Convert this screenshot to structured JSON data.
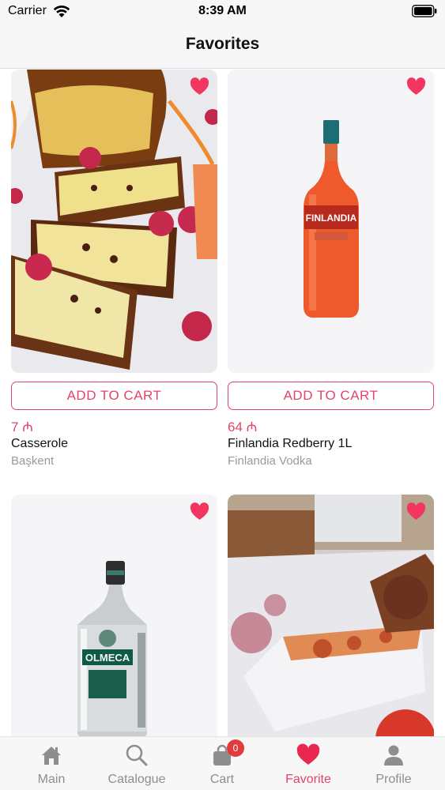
{
  "status_bar": {
    "carrier": "Carrier",
    "time": "8:39 AM"
  },
  "nav": {
    "title": "Favorites"
  },
  "products": [
    {
      "price": "7 ₼",
      "name": "Casserole",
      "brand": "Başkent",
      "add_label": "ADD TO CART",
      "image": "casserole-photo"
    },
    {
      "price": "64 ₼",
      "name": "Finlandia Redberry 1L",
      "brand": "Finlandia Vodka",
      "add_label": "ADD TO CART",
      "image": "finlandia-bottle",
      "bottle_label": "FINLANDIA"
    },
    {
      "image": "olmeca-bottle",
      "bottle_label": "OLMECA"
    },
    {
      "image": "dessert-roll-photo"
    }
  ],
  "tab_bar": {
    "tabs": [
      {
        "label": "Main",
        "icon": "home-icon"
      },
      {
        "label": "Catalogue",
        "icon": "search-icon"
      },
      {
        "label": "Cart",
        "icon": "bag-icon",
        "badge": "0"
      },
      {
        "label": "Favorite",
        "icon": "heart-icon",
        "active": true
      },
      {
        "label": "Profile",
        "icon": "person-icon"
      }
    ]
  },
  "colors": {
    "accent": "#e2456a",
    "badge": "#e23b3b",
    "inactive": "#8e8e8e"
  }
}
